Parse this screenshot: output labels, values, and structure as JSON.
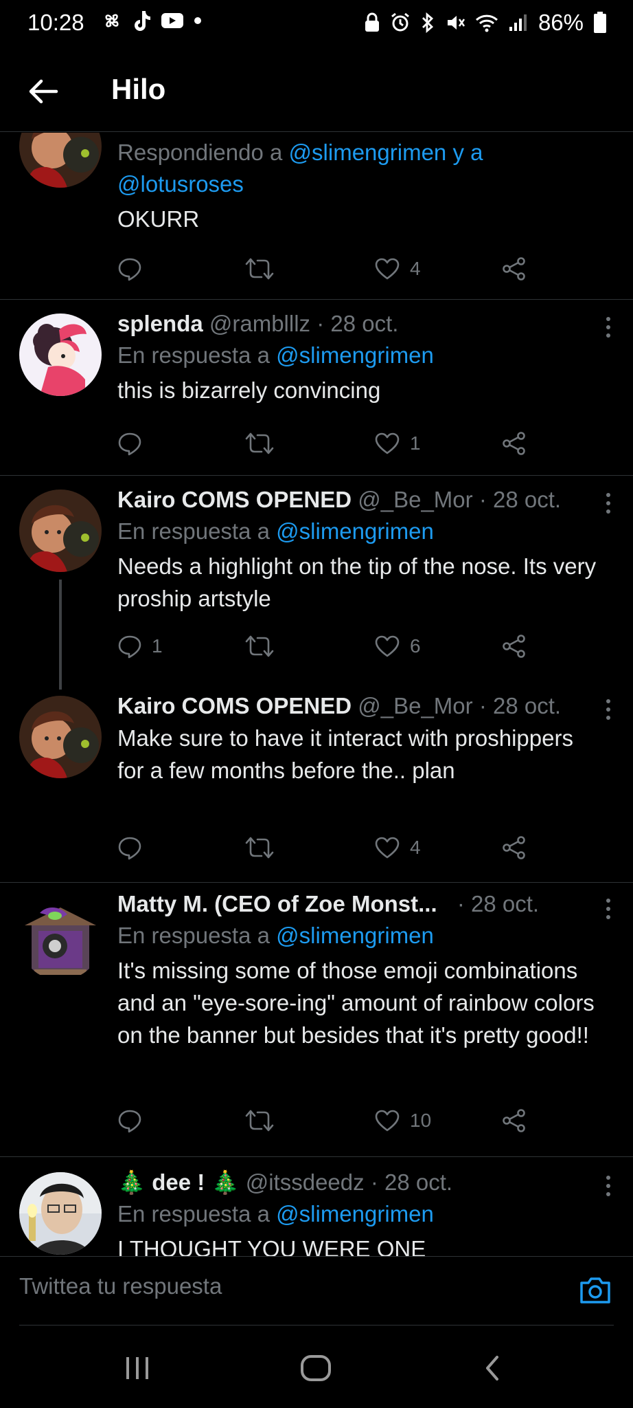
{
  "status_bar": {
    "time": "10:28",
    "battery": "86%"
  },
  "app_bar": {
    "title": "Hilo"
  },
  "tweets": [
    {
      "reply_prefix": "Respondiendo a",
      "mention1": "@slimengrimen",
      "conj": "y a",
      "mention2": "@lotusroses",
      "text": "OKURR",
      "replies": "",
      "retweets": "",
      "likes": "4"
    },
    {
      "name": "splenda",
      "handle": "@ramblllz",
      "date": "28 oct.",
      "reply_prefix": "En respuesta a",
      "mention": "@slimengrimen",
      "text": "this is bizarrely convincing",
      "replies": "",
      "likes": "1"
    },
    {
      "name": "Kairo COMS OPENED",
      "handle": "@_Be_Mor",
      "date": "28 oct.",
      "reply_prefix": "En respuesta a",
      "mention": "@slimengrimen",
      "text": "Needs a highlight on the tip of the nose. Its very proship artstyle",
      "replies": "1",
      "likes": "6"
    },
    {
      "name": "Kairo COMS OPENED",
      "handle": "@_Be_Mor",
      "date": "28 oct.",
      "text": "Make sure to have it interact with proshippers for a few months before the.. plan",
      "replies": "",
      "likes": "4"
    },
    {
      "name": "Matty M. (CEO of Zoe Monst...",
      "date": "28 oct.",
      "reply_prefix": "En respuesta a",
      "mention": "@slimengrimen",
      "text": "It's missing some of those emoji combinations and an \"eye-sore-ing\" amount of rainbow colors on the banner but besides that it's pretty good!!",
      "replies": "",
      "likes": "10"
    },
    {
      "name": "🎄 dee ! 🎄",
      "handle": "@itssdeedz",
      "date": "28 oct.",
      "reply_prefix": "En respuesta a",
      "mention": "@slimengrimen",
      "text": "I THOUGHT YOU WERE ONE"
    }
  ],
  "composer": {
    "placeholder": "Twittea tu respuesta"
  },
  "icons": {
    "back": "arrow-left-icon",
    "reply": "reply-bubble-icon",
    "retweet": "retweet-icon",
    "like": "heart-icon",
    "share": "share-icon",
    "more": "more-vertical-icon",
    "camera": "camera-icon"
  },
  "colors": {
    "background": "#000000",
    "accent": "#1d9bf0",
    "secondary_text": "#71767b",
    "divider": "#2f3336"
  }
}
